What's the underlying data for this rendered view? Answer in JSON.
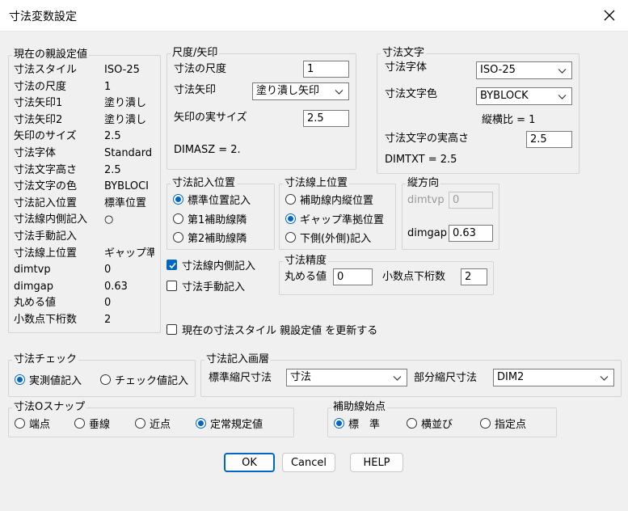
{
  "window": {
    "title": "寸法変数設定"
  },
  "current": {
    "legend": "現在の親設定値",
    "rows": [
      {
        "label": "寸法スタイル",
        "value": "ISO-25"
      },
      {
        "label": "寸法の尺度",
        "value": "1"
      },
      {
        "label": "寸法矢印1",
        "value": "塗り潰し"
      },
      {
        "label": "寸法矢印2",
        "value": "塗り潰し"
      },
      {
        "label": "矢印のサイズ",
        "value": "2.5"
      },
      {
        "label": "寸法字体",
        "value": "Standard"
      },
      {
        "label": "寸法文字高さ",
        "value": "2.5"
      },
      {
        "label": "寸法文字の色",
        "value": "BYBLOCI"
      },
      {
        "label": "寸法記入位置",
        "value": "標準位置"
      },
      {
        "label": "寸法線内側記入",
        "value": "○"
      },
      {
        "label": "寸法手動記入",
        "value": ""
      },
      {
        "label": "寸法線上位置",
        "value": "ギャップ準"
      },
      {
        "label": "dimtvp",
        "value": "0"
      },
      {
        "label": "dimgap",
        "value": "0.63"
      },
      {
        "label": "丸める値",
        "value": "0"
      },
      {
        "label": "小数点下桁数",
        "value": "2"
      }
    ]
  },
  "scale": {
    "legend": "尺度/矢印",
    "scale_label": "寸法の尺度",
    "scale_value": "1",
    "arrow_label": "寸法矢印",
    "arrow_value": "塗り潰し矢印",
    "size_label": "矢印の実サイズ",
    "size_value": "2.5",
    "dimasz": "DIMASZ =  2."
  },
  "text": {
    "legend": "寸法文字",
    "font_label": "寸法字体",
    "font_value": "ISO-25",
    "color_label": "寸法文字色",
    "color_value": "BYBLOCK",
    "ratio": "縦横比 = 1",
    "height_label": "寸法文字の実高さ",
    "height_value": "2.5",
    "dimtxt": "DIMTXT =  2.5"
  },
  "position": {
    "legend": "寸法記入位置",
    "options": [
      "標準位置記入",
      "第1補助線隣",
      "第2補助線隣"
    ]
  },
  "above": {
    "legend": "寸法線上位置",
    "options": [
      "補助線内縦位置",
      "ギャップ準拠位置",
      "下側(外側)記入"
    ]
  },
  "vertical": {
    "legend": "縦方向",
    "dimtvp_label": "dimtvp",
    "dimtvp_value": "0",
    "dimgap_label": "dimgap",
    "dimgap_value": "0.63"
  },
  "checks": {
    "inside": "寸法線内側記入",
    "manual": "寸法手動記入",
    "update": "現在の寸法スタイル 親設定値 を更新する"
  },
  "precision": {
    "legend": "寸法精度",
    "round_label": "丸める値",
    "round_value": "0",
    "decimals_label": "小数点下桁数",
    "decimals_value": "2"
  },
  "dimcheck": {
    "legend": "寸法チェック",
    "options": [
      "実測値記入",
      "チェック値記入"
    ]
  },
  "layer": {
    "legend": "寸法記入画層",
    "std_label": "標準縮尺寸法",
    "std_value": "寸法",
    "part_label": "部分縮尺寸法",
    "part_value": "DIM2"
  },
  "osnap": {
    "legend": "寸法Oスナップ",
    "options": [
      "端点",
      "垂線",
      "近点",
      "定常規定値"
    ]
  },
  "extorigin": {
    "legend": "補助線始点",
    "options": [
      "標　準",
      "横並び",
      "指定点"
    ]
  },
  "buttons": {
    "ok": "OK",
    "cancel": "Cancel",
    "help": "HELP"
  },
  "colors": {
    "accent": "#0067c0"
  }
}
